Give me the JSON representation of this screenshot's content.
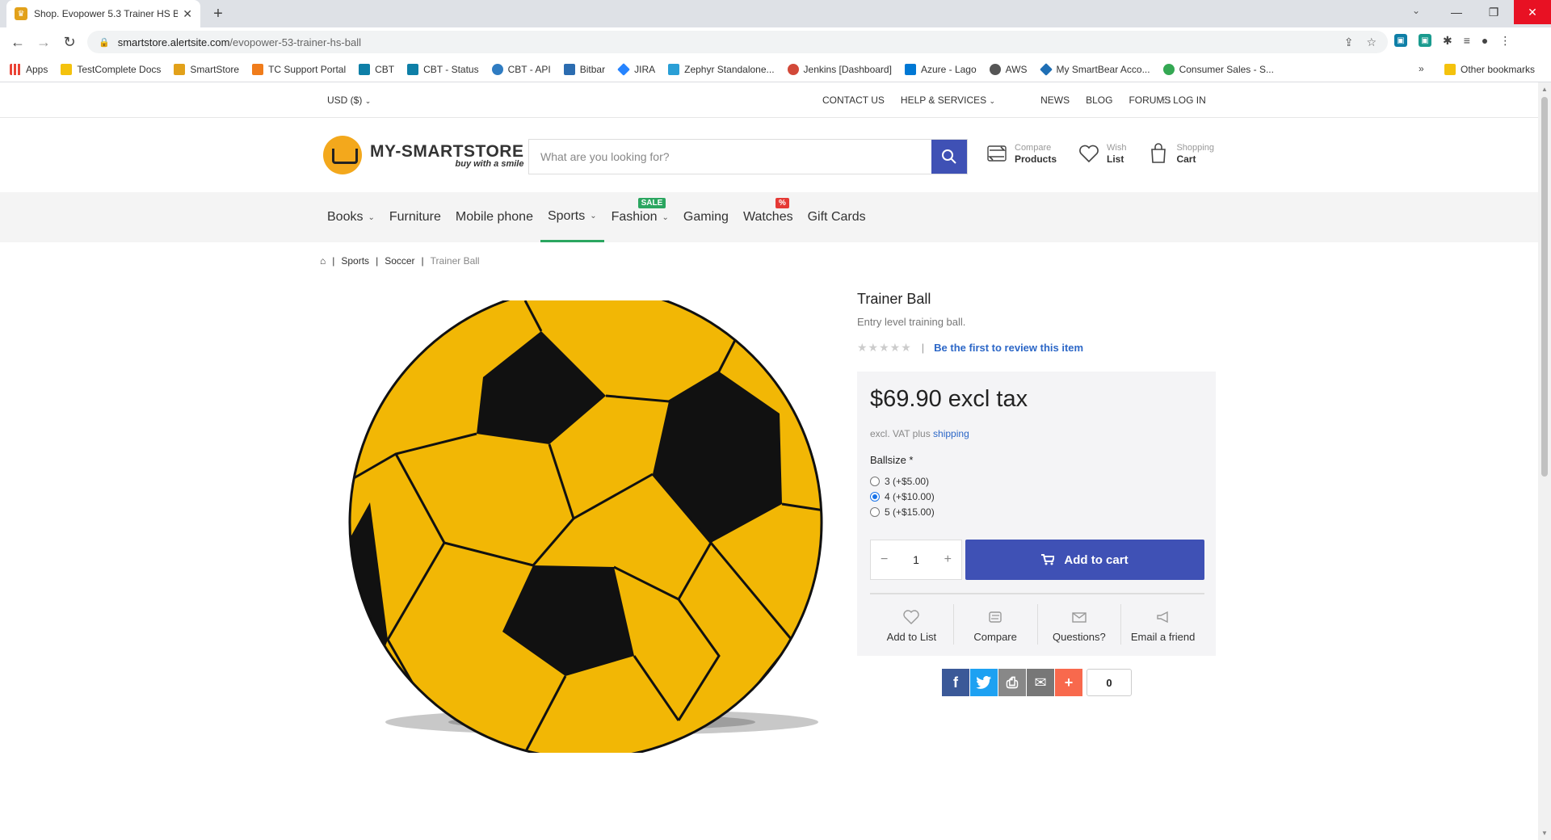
{
  "browser": {
    "tab_title": "Shop. Evopower 5.3 Trainer HS B",
    "url_host": "smartstore.alertsite.com",
    "url_path": "/evopower-53-trainer-hs-ball",
    "new_tab": "+",
    "bookmarks": [
      {
        "label": "Apps",
        "color": "#ea4335"
      },
      {
        "label": "TestComplete Docs",
        "color": "#f4c20d"
      },
      {
        "label": "SmartStore",
        "color": "#e2a11a"
      },
      {
        "label": "TC Support Portal",
        "color": "#f07c1b"
      },
      {
        "label": "CBT",
        "color": "#0e7fa7"
      },
      {
        "label": "CBT - Status",
        "color": "#0e7fa7"
      },
      {
        "label": "CBT - API",
        "color": "#2f7cc2"
      },
      {
        "label": "Bitbar",
        "color": "#2b6cb0"
      },
      {
        "label": "JIRA",
        "color": "#2684ff"
      },
      {
        "label": "Zephyr Standalone...",
        "color": "#2a9fd6"
      },
      {
        "label": "Jenkins [Dashboard]",
        "color": "#d24939"
      },
      {
        "label": "Azure - Lago",
        "color": "#0078d4"
      },
      {
        "label": "AWS",
        "color": "#555555"
      },
      {
        "label": "My SmartBear Acco...",
        "color": "#1f6fb5"
      },
      {
        "label": "Consumer Sales - S...",
        "color": "#34a853"
      }
    ],
    "bookmarks_more": "»",
    "other_bookmarks": "Other bookmarks"
  },
  "topbar": {
    "currency": "USD ($)",
    "links": [
      "CONTACT US",
      "HELP & SERVICES"
    ],
    "links2": [
      "NEWS",
      "BLOG",
      "FORUMS"
    ],
    "login": "LOG IN"
  },
  "header": {
    "logo_name": "MY-SMARTSTORE",
    "logo_slogan": "buy with a smile",
    "search_placeholder": "What are you looking for?",
    "compare_l1": "Compare",
    "compare_l2": "Products",
    "wish_l1": "Wish",
    "wish_l2": "List",
    "cart_l1": "Shopping",
    "cart_l2": "Cart"
  },
  "menu": {
    "items": [
      "Books",
      "Furniture",
      "Mobile phone",
      "Sports",
      "Fashion",
      "Gaming",
      "Watches",
      "Gift Cards"
    ],
    "sale_badge": "SALE",
    "percent_badge": "%",
    "accent": "#2ba660"
  },
  "breadcrumb": {
    "items": [
      "Sports",
      "Soccer"
    ],
    "current": "Trainer Ball"
  },
  "product": {
    "title": "Trainer Ball",
    "short_desc": "Entry level training ball.",
    "review_link": "Be the first to review this item",
    "price": "$69.90 excl tax",
    "tax_prefix": "excl. VAT plus",
    "tax_link": "shipping",
    "attribute_label": "Ballsize *",
    "options": [
      "3 (+$5.00)",
      "4 (+$10.00)",
      "5 (+$15.00)"
    ],
    "selected_option": 1,
    "quantity": "1",
    "add_to_cart": "Add to cart",
    "actions": [
      "Add to List",
      "Compare",
      "Questions?",
      "Email a friend"
    ],
    "share_count": "0",
    "primary_color": "#3f51b5"
  }
}
